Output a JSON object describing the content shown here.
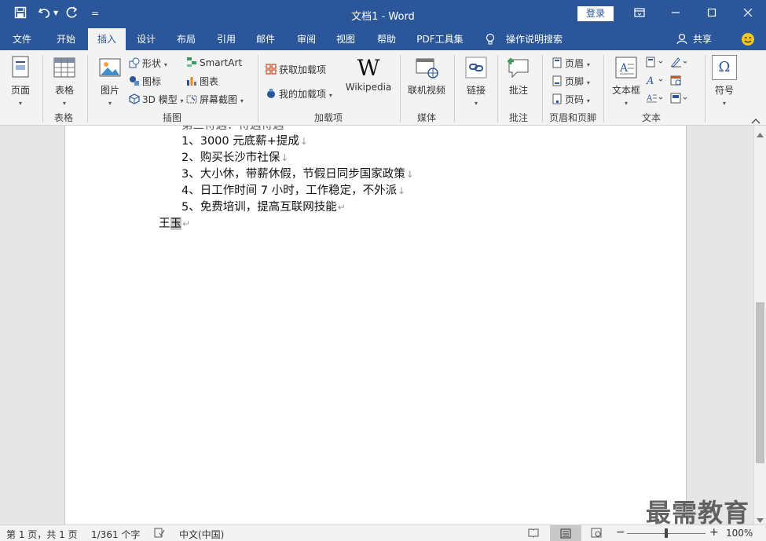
{
  "titlebar": {
    "title": "文档1  -  Word",
    "login_label": "登录",
    "quick_access_customize": "="
  },
  "tabs": [
    {
      "label": "文件"
    },
    {
      "label": "开始"
    },
    {
      "label": "插入",
      "active": true
    },
    {
      "label": "设计"
    },
    {
      "label": "布局"
    },
    {
      "label": "引用"
    },
    {
      "label": "邮件"
    },
    {
      "label": "审阅"
    },
    {
      "label": "视图"
    },
    {
      "label": "帮助"
    },
    {
      "label": "PDF工具集"
    },
    {
      "label": "操作说明搜索"
    },
    {
      "label": "共享"
    }
  ],
  "ribbon": {
    "pages": {
      "button": "页面"
    },
    "tables": {
      "button": "表格",
      "group": "表格"
    },
    "illustrations": {
      "group": "插图",
      "picture": "图片",
      "shapes": "形状",
      "icons": "图标",
      "model3d": "3D 模型",
      "smartart": "SmartArt",
      "chart": "图表",
      "screenshot": "屏幕截图"
    },
    "addins": {
      "group": "加载项",
      "get": "获取加载项",
      "mine": "我的加载项",
      "wikipedia": "Wikipedia",
      "wiki_glyph": "W"
    },
    "media": {
      "group": "媒体",
      "online_video": "联机视频"
    },
    "links": {
      "button": "链接"
    },
    "comments": {
      "group": "批注",
      "button": "批注"
    },
    "header_footer": {
      "group": "页眉和页脚",
      "header": "页眉",
      "footer": "页脚",
      "page_number": "页码"
    },
    "text": {
      "group": "文本",
      "textbox": "文本框"
    },
    "symbols": {
      "button": "符号",
      "glyph": "Ω"
    }
  },
  "document": {
    "partial_line": "第三待遇：待遇待遇",
    "lines": [
      "1、3000 元底薪+提成",
      "2、购买长沙市社保",
      "3、大小休，带薪休假，节假日同步国家政策",
      "4、日工作时间 7 小时，工作稳定，不外派",
      "5、免费培训，提高互联网技能"
    ],
    "signature_prefix": "王",
    "signature_selected": "玉",
    "line_break_mark": "↓",
    "para_mark": "↵"
  },
  "statusbar": {
    "page": "第 1 页，共 1 页",
    "words": "1/361 个字",
    "language": "中文(中国)",
    "zoom": "100%",
    "zoom_level": 1.0
  },
  "watermark": "最需教育",
  "colors": {
    "accent": "#2b579a",
    "ribbon_bg": "#f3f3f3",
    "canvas_bg": "#e6e6e6"
  }
}
